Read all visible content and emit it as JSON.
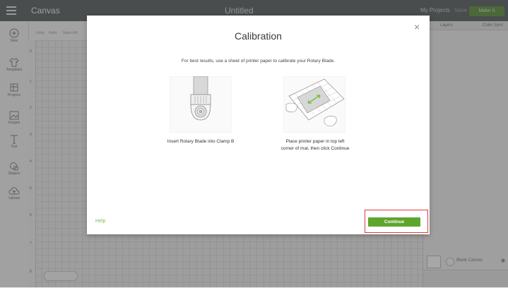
{
  "app": {
    "title": "Canvas",
    "document_title": "Untitled"
  },
  "topbar": {
    "my_projects": "My Projects",
    "save": "Save",
    "make_it": "Make It"
  },
  "toolbar": {
    "items": [
      "Undo",
      "Redo",
      "Select All"
    ]
  },
  "sidebar": {
    "items": [
      {
        "label": "New",
        "icon": "plus-circle-icon"
      },
      {
        "label": "Templates",
        "icon": "shirt-icon"
      },
      {
        "label": "Projects",
        "icon": "projects-icon"
      },
      {
        "label": "Images",
        "icon": "image-icon"
      },
      {
        "label": "Text",
        "icon": "text-icon"
      },
      {
        "label": "Shapes",
        "icon": "shapes-icon"
      },
      {
        "label": "Upload",
        "icon": "cloud-upload-icon"
      }
    ]
  },
  "ruler": {
    "marks": [
      "0",
      "1",
      "2",
      "3",
      "4",
      "5",
      "6",
      "7",
      "8"
    ]
  },
  "layers_panel": {
    "tabs": [
      "Layers",
      "Color Sync"
    ],
    "blank_canvas_label": "Blank Canvas"
  },
  "modal": {
    "title": "Calibration",
    "instruction": "For best results, use a sheet of printer paper to calibrate your Rotary Blade.",
    "step1_caption": "Insert Rotary Blade into Clamp B",
    "step2_caption_line1": "Place printer paper in top left",
    "step2_caption_line2": "corner of mat, then click Continue",
    "help_label": "Help",
    "continue_label": "Continue",
    "close_glyph": "×"
  },
  "colors": {
    "accent_green": "#5ea52d",
    "highlight_red": "#e03a3e",
    "topbar": "#555b5e"
  }
}
